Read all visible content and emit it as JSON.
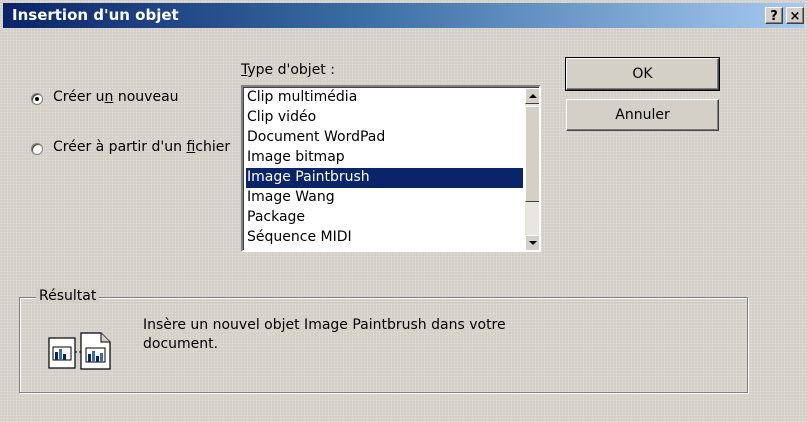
{
  "window": {
    "title": "Insertion d'un objet",
    "help_button": "?",
    "close_button": "×"
  },
  "options": {
    "create_new": {
      "pre": "Créer u",
      "accel": "n",
      "post": " nouveau",
      "selected": true
    },
    "create_from_file": {
      "pre": "Créer à partir d'un ",
      "accel": "f",
      "post": "ichier",
      "selected": false
    }
  },
  "object_type": {
    "label_accel": "T",
    "label_rest": "ype d'objet :",
    "items": [
      "Clip multimédia",
      "Clip vidéo",
      "Document WordPad",
      "Image bitmap",
      "Image Paintbrush",
      "Image Wang",
      "Package",
      "Séquence MIDI"
    ],
    "selected_index": 4
  },
  "buttons": {
    "ok": "OK",
    "cancel": "Annuler"
  },
  "result": {
    "legend": "Résultat",
    "line1": "Insère un nouvel objet Image Paintbrush dans votre",
    "line2": "document.",
    "icon": "object-document-icon"
  },
  "colors": {
    "titlebar_start": "#0a246a",
    "titlebar_end": "#a6caf0",
    "selection": "#0a246a",
    "face": "#d4d0c8"
  }
}
